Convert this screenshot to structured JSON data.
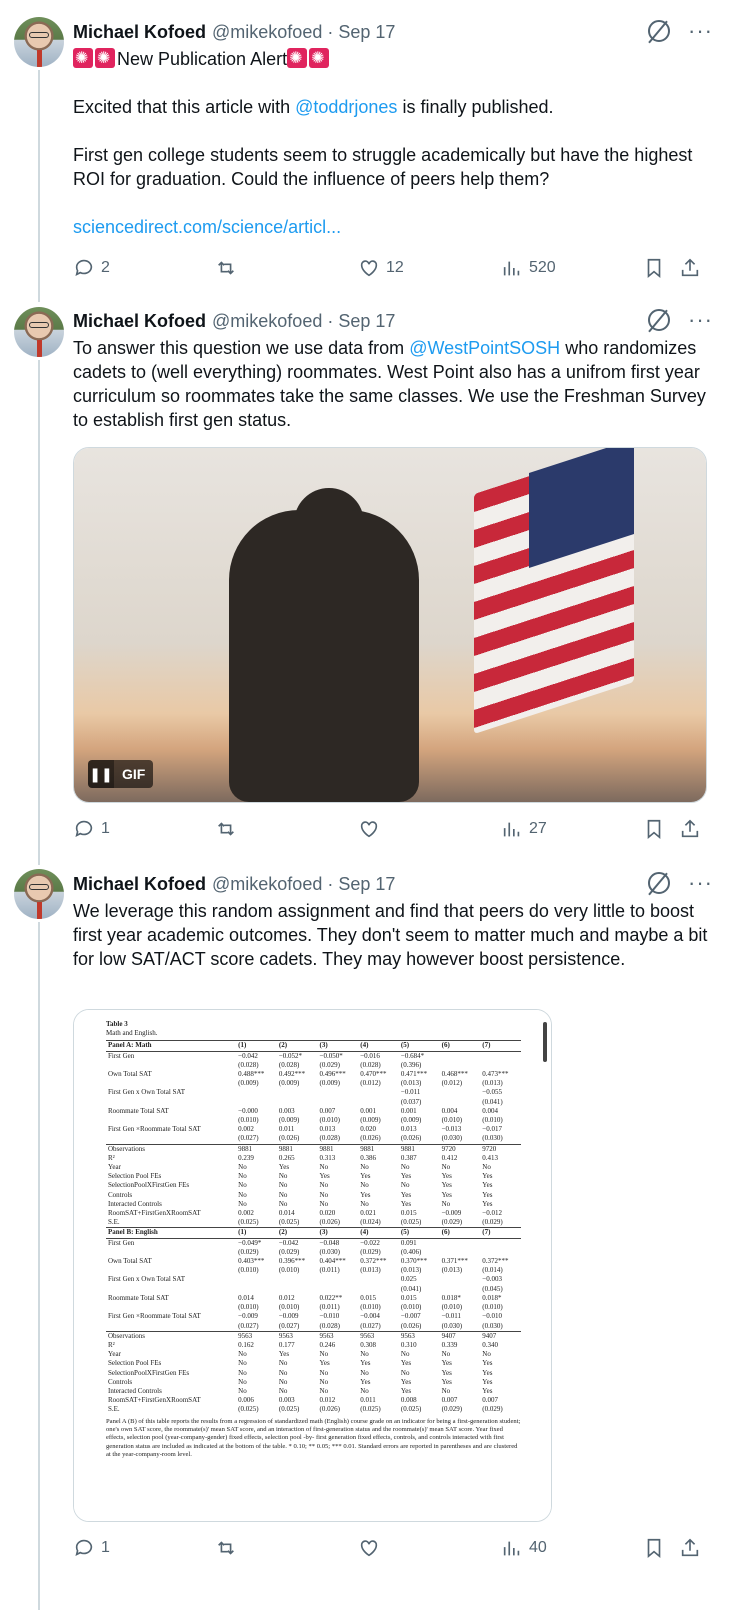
{
  "tweets": [
    {
      "name": "Michael Kofoed",
      "handle": "@mikekofoed · Sep 17",
      "title_line": "New Publication Alert",
      "para1_prefix": "Excited that this article with ",
      "para1_mention": "@toddrjones",
      "para1_suffix": " is finally published.",
      "para2": "First gen college students seem to struggle academically but have the highest ROI for graduation. Could the influence of peers help them?",
      "link": "sciencedirect.com/science/articl...",
      "replies": "2",
      "reposts": "",
      "likes": "12",
      "views": "520"
    },
    {
      "name": "Michael Kofoed",
      "handle": "@mikekofoed · Sep 17",
      "text_prefix": "To answer this question we use data from ",
      "text_mention": "@WestPointSOSH",
      "text_suffix": " who randomizes cadets to (well everything) roommates. West Point also has a unifrom first year curriculum so roommates take the same classes. We use the Freshman Survey to establish first gen status.",
      "gif_label": "GIF",
      "replies": "1",
      "reposts": "",
      "likes": "",
      "views": "27"
    },
    {
      "name": "Michael Kofoed",
      "handle": "@mikekofoed · Sep 17",
      "text": "We leverage this random assignment and find that peers do very little to boost first year academic outcomes. They don't seem to matter much and maybe a bit for low SAT/ACT score cadets. They may however boost persistence.",
      "replies": "1",
      "reposts": "",
      "likes": "",
      "views": "40"
    }
  ],
  "table_image": {
    "title": "Table 3",
    "subtitle": "Math and English.",
    "panel_a": {
      "header": [
        "Panel A: Math",
        "(1)",
        "(2)",
        "(3)",
        "(4)",
        "(5)",
        "(6)",
        "(7)"
      ],
      "rows": [
        [
          "First Gen",
          "−0.042",
          "−0.052*",
          "−0.050*",
          "−0.016",
          "−0.684*",
          "",
          ""
        ],
        [
          "",
          "(0.028)",
          "(0.028)",
          "(0.029)",
          "(0.028)",
          "(0.396)",
          "",
          ""
        ],
        [
          "Own Total SAT",
          "0.488***",
          "0.492***",
          "0.496***",
          "0.470***",
          "0.471***",
          "0.468***",
          "0.473***"
        ],
        [
          "",
          "(0.009)",
          "(0.009)",
          "(0.009)",
          "(0.012)",
          "(0.013)",
          "(0.012)",
          "(0.013)"
        ],
        [
          "First Gen x Own Total SAT",
          "",
          "",
          "",
          "",
          "−0.011",
          "",
          "−0.055"
        ],
        [
          "",
          "",
          "",
          "",
          "",
          "(0.037)",
          "",
          "(0.041)"
        ],
        [
          "Roommate Total SAT",
          "−0.000",
          "0.003",
          "0.007",
          "0.001",
          "0.001",
          "0.004",
          "0.004"
        ],
        [
          "",
          "(0.010)",
          "(0.009)",
          "(0.010)",
          "(0.009)",
          "(0.009)",
          "(0.010)",
          "(0.010)"
        ],
        [
          "First Gen ×Roommate Total SAT",
          "0.002",
          "0.011",
          "0.013",
          "0.020",
          "0.013",
          "−0.013",
          "−0.017"
        ],
        [
          "",
          "(0.027)",
          "(0.026)",
          "(0.028)",
          "(0.026)",
          "(0.026)",
          "(0.030)",
          "(0.030)"
        ]
      ],
      "stats": [
        [
          "Observations",
          "9881",
          "9881",
          "9881",
          "9881",
          "9881",
          "9720",
          "9720"
        ],
        [
          "R²",
          "0.239",
          "0.265",
          "0.313",
          "0.386",
          "0.387",
          "0.412",
          "0.413"
        ],
        [
          "Year",
          "No",
          "Yes",
          "No",
          "No",
          "No",
          "No",
          "No"
        ],
        [
          "Selection Pool FEs",
          "No",
          "No",
          "Yes",
          "Yes",
          "Yes",
          "Yes",
          "Yes"
        ],
        [
          "SelectionPoolXFirstGen FEs",
          "No",
          "No",
          "No",
          "No",
          "No",
          "Yes",
          "Yes"
        ],
        [
          "Controls",
          "No",
          "No",
          "No",
          "Yes",
          "Yes",
          "Yes",
          "Yes"
        ],
        [
          "Interacted Controls",
          "No",
          "No",
          "No",
          "No",
          "Yes",
          "No",
          "Yes"
        ],
        [
          "RoomSAT+FirstGenXRoomSAT",
          "0.002",
          "0.014",
          "0.020",
          "0.021",
          "0.015",
          "−0.009",
          "−0.012"
        ],
        [
          "S.E.",
          "(0.025)",
          "(0.025)",
          "(0.026)",
          "(0.024)",
          "(0.025)",
          "(0.029)",
          "(0.029)"
        ]
      ]
    },
    "panel_b": {
      "header": [
        "Panel B: English",
        "(1)",
        "(2)",
        "(3)",
        "(4)",
        "(5)",
        "(6)",
        "(7)"
      ],
      "rows": [
        [
          "First Gen",
          "−0.049*",
          "−0.042",
          "−0.048",
          "−0.022",
          "0.091",
          "",
          ""
        ],
        [
          "",
          "(0.029)",
          "(0.029)",
          "(0.030)",
          "(0.029)",
          "(0.406)",
          "",
          ""
        ],
        [
          "Own Total SAT",
          "0.403***",
          "0.396***",
          "0.404***",
          "0.372***",
          "0.370***",
          "0.371***",
          "0.372***"
        ],
        [
          "",
          "(0.010)",
          "(0.010)",
          "(0.011)",
          "(0.013)",
          "(0.013)",
          "(0.013)",
          "(0.014)"
        ],
        [
          "First Gen x Own Total SAT",
          "",
          "",
          "",
          "",
          "0.025",
          "",
          "−0.003"
        ],
        [
          "",
          "",
          "",
          "",
          "",
          "(0.041)",
          "",
          "(0.045)"
        ],
        [
          "Roommate Total SAT",
          "0.014",
          "0.012",
          "0.022**",
          "0.015",
          "0.015",
          "0.018*",
          "0.018*"
        ],
        [
          "",
          "(0.010)",
          "(0.010)",
          "(0.011)",
          "(0.010)",
          "(0.010)",
          "(0.010)",
          "(0.010)"
        ],
        [
          "First Gen ×Roommate Total SAT",
          "−0.009",
          "−0.009",
          "−0.010",
          "−0.004",
          "−0.007",
          "−0.011",
          "−0.010"
        ],
        [
          "",
          "(0.027)",
          "(0.027)",
          "(0.028)",
          "(0.027)",
          "(0.026)",
          "(0.030)",
          "(0.030)"
        ]
      ],
      "stats": [
        [
          "Observations",
          "9563",
          "9563",
          "9563",
          "9563",
          "9563",
          "9407",
          "9407"
        ],
        [
          "R²",
          "0.162",
          "0.177",
          "0.246",
          "0.308",
          "0.310",
          "0.339",
          "0.340"
        ],
        [
          "Year",
          "No",
          "Yes",
          "No",
          "No",
          "No",
          "No",
          "No"
        ],
        [
          "Selection Pool FEs",
          "No",
          "No",
          "Yes",
          "Yes",
          "Yes",
          "Yes",
          "Yes"
        ],
        [
          "SelectionPoolXFirstGen FEs",
          "No",
          "No",
          "No",
          "No",
          "No",
          "Yes",
          "Yes"
        ],
        [
          "Controls",
          "No",
          "No",
          "No",
          "Yes",
          "Yes",
          "Yes",
          "Yes"
        ],
        [
          "Interacted Controls",
          "No",
          "No",
          "No",
          "No",
          "Yes",
          "No",
          "Yes"
        ],
        [
          "RoomSAT+FirstGenXRoomSAT",
          "0.006",
          "0.003",
          "0.012",
          "0.011",
          "0.008",
          "0.007",
          "0.007"
        ],
        [
          "S.E.",
          "(0.025)",
          "(0.025)",
          "(0.026)",
          "(0.025)",
          "(0.025)",
          "(0.029)",
          "(0.029)"
        ]
      ]
    },
    "note": "Panel A (B) of this table reports the results from a regression of standardized math (English) course grade on an indicator for being a first-generation student; one's own SAT score, the roommate(s)' mean SAT score, and an interaction of first-generation status and the roommate(s)' mean SAT score. Year fixed effects, selection pool (year-company-gender) fixed effects, selection pool -by- first generation fixed effects, controls, and controls interacted with first generation status are included as indicated at the bottom of the table. * 0.10; ** 0.05; *** 0.01. Standard errors are reported in parentheses and are clustered at the year-company-room level."
  }
}
